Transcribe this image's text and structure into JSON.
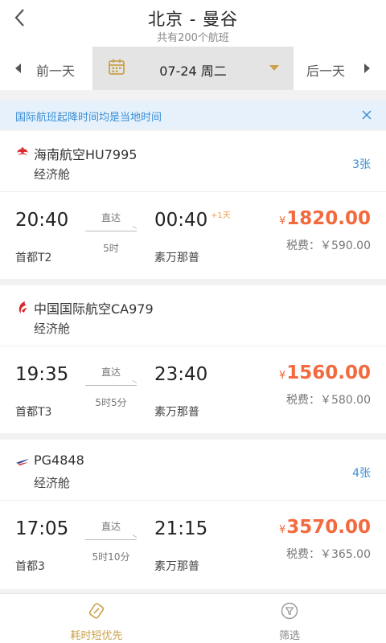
{
  "header": {
    "title": "北京 - 曼谷",
    "subtitle": "共有200个航班"
  },
  "datebar": {
    "prev_label": "前一天",
    "date_label": "07-24 周二",
    "next_label": "后一天"
  },
  "notice": {
    "text": "国际航班起降时间均是当地时间"
  },
  "flights": [
    {
      "airline": "海南航空HU7995",
      "cabin": "经济舱",
      "seats": "3张",
      "dep_time": "20:40",
      "dep_airport": "首都T2",
      "direct": "直达",
      "duration": "5时",
      "arr_time": "00:40",
      "plus_day": "+1天",
      "arr_airport": "素万那普",
      "currency": "¥",
      "price": "1820.00",
      "tax": "税费：￥590.00"
    },
    {
      "airline": "中国国际航空CA979",
      "cabin": "经济舱",
      "seats": "",
      "dep_time": "19:35",
      "dep_airport": "首都T3",
      "direct": "直达",
      "duration": "5时5分",
      "arr_time": "23:40",
      "plus_day": "",
      "arr_airport": "素万那普",
      "currency": "¥",
      "price": "1560.00",
      "tax": "税费：￥580.00"
    },
    {
      "airline": "PG4848",
      "cabin": "经济舱",
      "seats": "4张",
      "dep_time": "17:05",
      "dep_airport": "首都3",
      "direct": "直达",
      "duration": "5时10分",
      "arr_time": "21:15",
      "plus_day": "",
      "arr_airport": "素万那普",
      "currency": "¥",
      "price": "3570.00",
      "tax": "税费：￥365.00"
    }
  ],
  "tabbar": {
    "sort_label": "耗时短优先",
    "filter_label": "筛选"
  },
  "colors": {
    "accent": "#c9a24a",
    "price": "#f26a3d",
    "link": "#3a8ed6",
    "notice_bg": "#e6f1fb"
  },
  "icons": {
    "back": "chevron-left-icon",
    "calendar": "calendar-icon",
    "close": "close-icon",
    "hainan": "hainan-airlines-logo-icon",
    "airchina": "air-china-phoenix-logo-icon",
    "bangkok": "bangkok-airways-logo-icon",
    "sort": "duration-sort-icon",
    "filter": "filter-funnel-icon"
  }
}
